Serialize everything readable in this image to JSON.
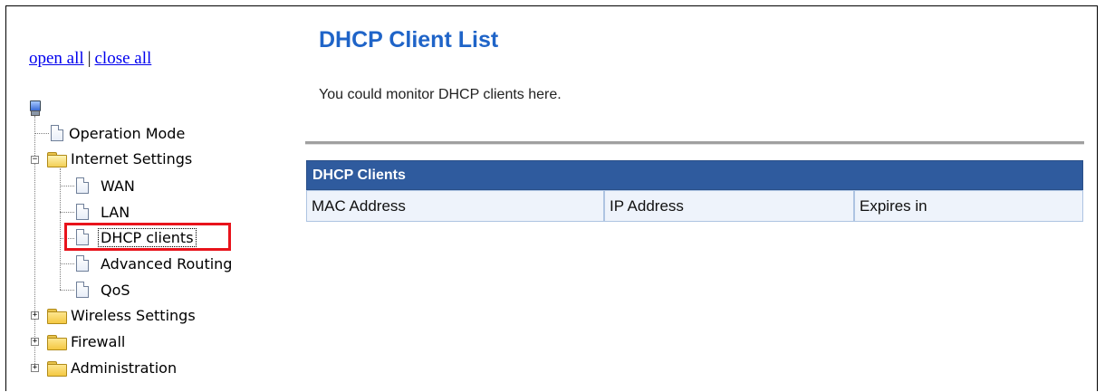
{
  "nav": {
    "open_all": "open all",
    "separator": "|",
    "close_all": "close all"
  },
  "tree": {
    "items": [
      {
        "label": "Operation Mode",
        "icon": "page-icon"
      },
      {
        "label": "Internet Settings",
        "icon": "folder-open-icon",
        "expanded": true
      },
      {
        "label": "WAN",
        "icon": "page-icon"
      },
      {
        "label": "LAN",
        "icon": "page-icon"
      },
      {
        "label": "DHCP clients",
        "icon": "page-icon",
        "selected": true
      },
      {
        "label": "Advanced Routing",
        "icon": "page-icon"
      },
      {
        "label": "QoS",
        "icon": "page-icon"
      },
      {
        "label": "Wireless Settings",
        "icon": "folder-icon",
        "expanded": false
      },
      {
        "label": "Firewall",
        "icon": "folder-icon",
        "expanded": false
      },
      {
        "label": "Administration",
        "icon": "folder-icon",
        "expanded": false
      }
    ],
    "toggle_expanded": "−",
    "toggle_collapsed": "+"
  },
  "main": {
    "title": "DHCP Client List",
    "description": "You could monitor DHCP clients here.",
    "table": {
      "caption": "DHCP Clients",
      "columns": [
        "MAC Address",
        "IP Address",
        "Expires in"
      ]
    }
  },
  "colors": {
    "title": "#1f64c8",
    "table_header": "#2f5b9e",
    "table_cell": "#eef3fb",
    "highlight": "#e8131b"
  }
}
